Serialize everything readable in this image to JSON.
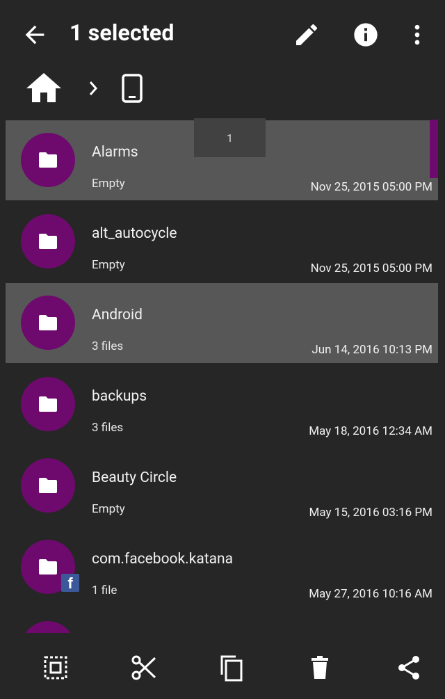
{
  "appbar": {
    "title": "1 selected",
    "icons": {
      "back": "arrow-back-icon",
      "edit": "pencil-icon",
      "info": "info-icon",
      "more": "more-vert-icon"
    }
  },
  "breadcrumb": {
    "icons": [
      "home-icon",
      "chevron-right-icon",
      "phone-icon"
    ]
  },
  "fast_scroll_label": "1",
  "items": [
    {
      "name": "Alarms",
      "meta": "Empty",
      "date": "Nov 25, 2015 05:00 PM",
      "selected": true
    },
    {
      "name": "alt_autocycle",
      "meta": "Empty",
      "date": "Nov 25, 2015 05:00 PM",
      "selected": false
    },
    {
      "name": "Android",
      "meta": "3 files",
      "date": "Jun 14, 2016 10:13 PM",
      "selected": true
    },
    {
      "name": "backups",
      "meta": "3 files",
      "date": "May 18, 2016 12:34 AM",
      "selected": false
    },
    {
      "name": "Beauty Circle",
      "meta": "Empty",
      "date": "May 15, 2016 03:16 PM",
      "selected": false
    },
    {
      "name": "com.facebook.katana",
      "meta": "1 file",
      "date": "May 27, 2016 10:16 AM",
      "selected": false,
      "badge": "f"
    }
  ],
  "bottom_actions": [
    "select-all-icon",
    "cut-icon",
    "copy-icon",
    "delete-icon",
    "share-icon"
  ],
  "colors": {
    "background": "#262626",
    "selected_row": "#575757",
    "folder_accent": "#6e0a6e",
    "facebook_badge": "#3b5998"
  }
}
